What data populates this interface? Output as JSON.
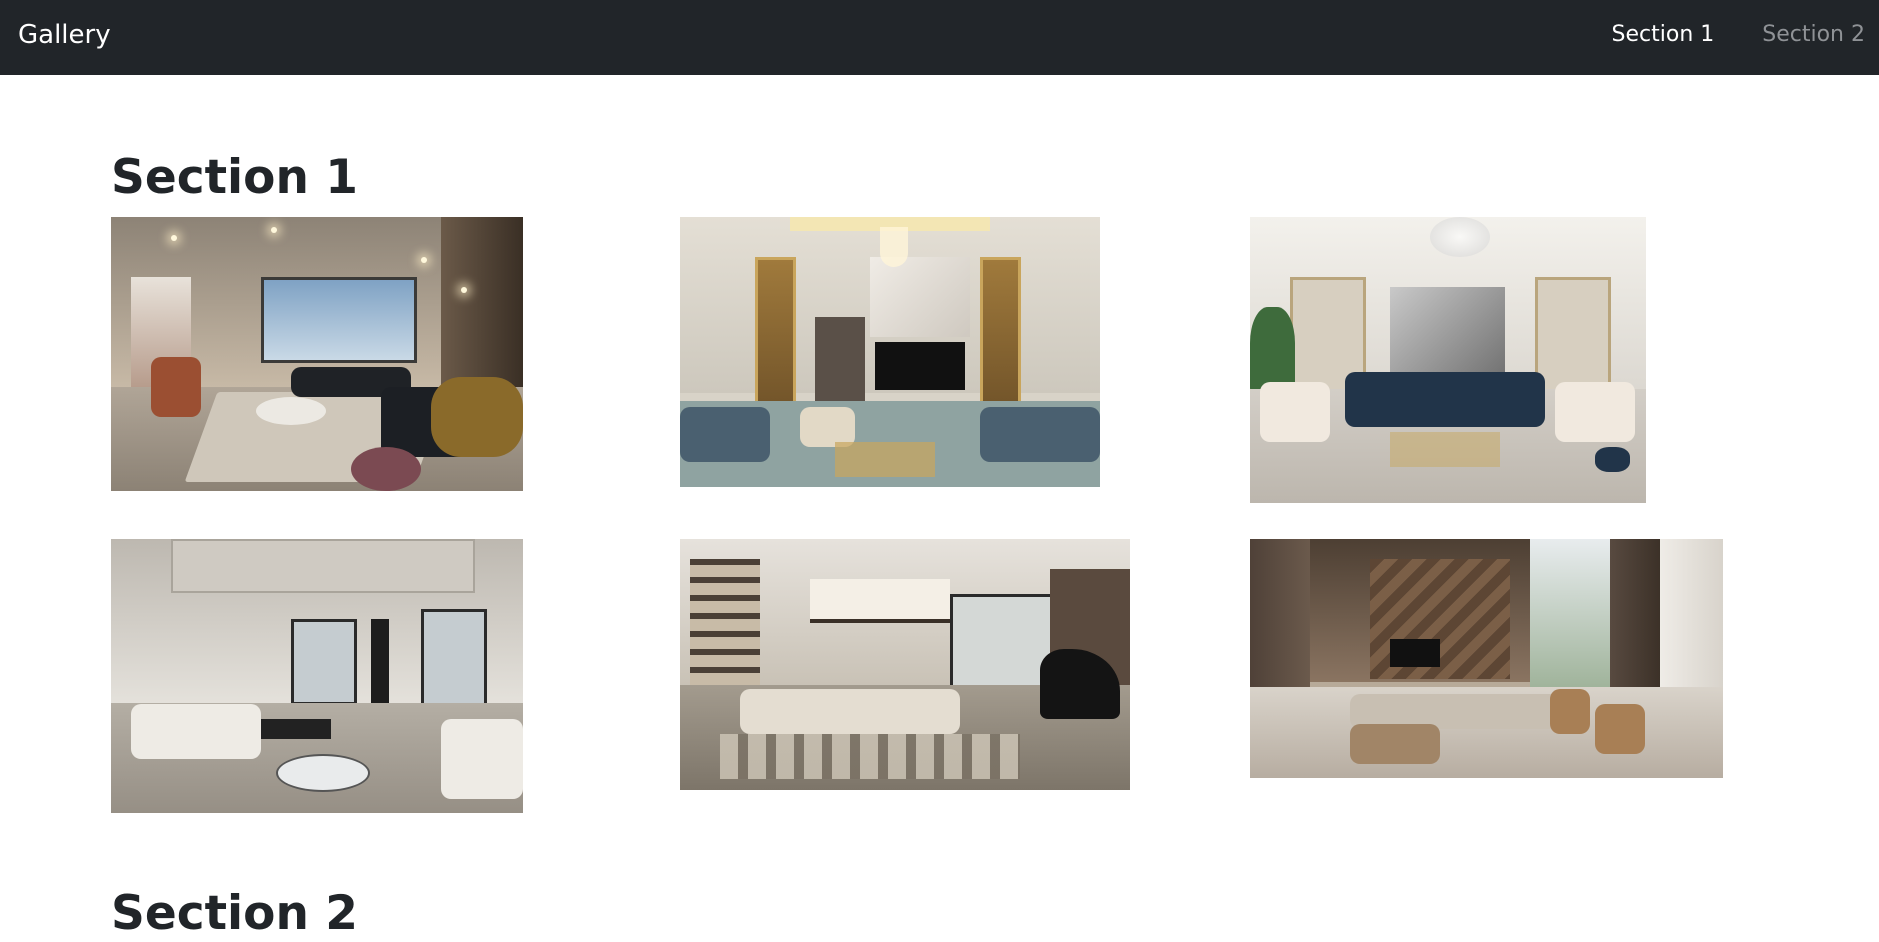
{
  "navbar": {
    "brand": "Gallery",
    "links": [
      {
        "label": "Section 1",
        "active": true
      },
      {
        "label": "Section 2",
        "active": false
      }
    ]
  },
  "sections": [
    {
      "title": "Section 1",
      "images": [
        {
          "subject": "living room with tall windows and lounge chair"
        },
        {
          "subject": "living room with gold accent wall and TV"
        },
        {
          "subject": "white living room with blue sofa and chandelier"
        },
        {
          "subject": "coffered-ceiling living room with white sectional"
        },
        {
          "subject": "double-height living room with bookshelf and grand piano"
        },
        {
          "subject": "wood-paneled living room with sectional and curtains"
        }
      ]
    },
    {
      "title": "Section 2"
    }
  ],
  "colors": {
    "navbar_bg": "#212529",
    "nav_active": "#ffffff",
    "nav_inactive": "#8f9296",
    "heading": "#212529"
  }
}
